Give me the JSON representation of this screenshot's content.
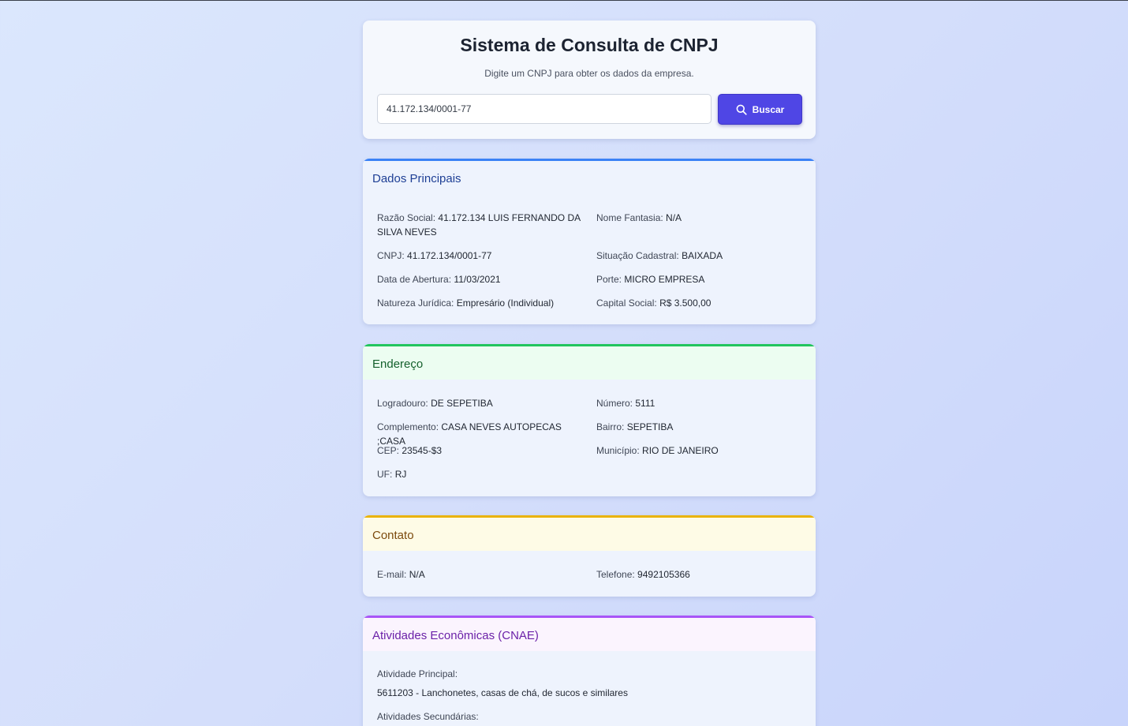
{
  "search": {
    "title": "Sistema de Consulta de CNPJ",
    "subtitle": "Digite um CNPJ para obter os dados da empresa.",
    "input_value": "41.172.134/0001-77",
    "button_label": "Buscar",
    "button_icon": "search-icon"
  },
  "dados": {
    "heading": "Dados Principais",
    "razao_label": "Razão Social:",
    "razao_value": "41.172.134 LUIS FERNANDO DA SILVA NEVES",
    "fantasia_label": "Nome Fantasia:",
    "fantasia_value": "N/A",
    "cnpj_label": "CNPJ:",
    "cnpj_value": "41.172.134/0001-77",
    "situacao_label": "Situação Cadastral:",
    "situacao_value": "BAIXADA",
    "abertura_label": "Data de Abertura:",
    "abertura_value": "11/03/2021",
    "porte_label": "Porte:",
    "porte_value": "MICRO EMPRESA",
    "natureza_label": "Natureza Jurídica:",
    "natureza_value": "Empresário (Individual)",
    "capital_label": "Capital Social:",
    "capital_value": "R$ 3.500,00"
  },
  "endereco": {
    "heading": "Endereço",
    "logradouro_label": "Logradouro:",
    "logradouro_value": "DE SEPETIBA",
    "numero_label": "Número:",
    "numero_value": "5111",
    "complemento_label": "Complemento:",
    "complemento_value": "CASA NEVES AUTOPECAS ;CASA",
    "bairro_label": "Bairro:",
    "bairro_value": "SEPETIBA",
    "cep_label": "CEP:",
    "cep_value": "23545-$3",
    "municipio_label": "Município:",
    "municipio_value": "RIO DE JANEIRO",
    "uf_label": "UF:",
    "uf_value": "RJ"
  },
  "contato": {
    "heading": "Contato",
    "email_label": "E-mail:",
    "email_value": "N/A",
    "telefone_label": "Telefone:",
    "telefone_value": "9492105366"
  },
  "cnae": {
    "heading": "Atividades Econômicas (CNAE)",
    "principal_label": "Atividade Principal:",
    "principal_value": "5611203 - Lanchonetes, casas de chá, de sucos e similares",
    "secundarias_label": "Atividades Secundárias:"
  },
  "colors": {
    "accent_button": "#4f46e5",
    "dados_accent": "#3b82f6",
    "endereco_accent": "#22c55e",
    "contato_accent": "#eab308",
    "cnae_accent": "#a855f7"
  }
}
